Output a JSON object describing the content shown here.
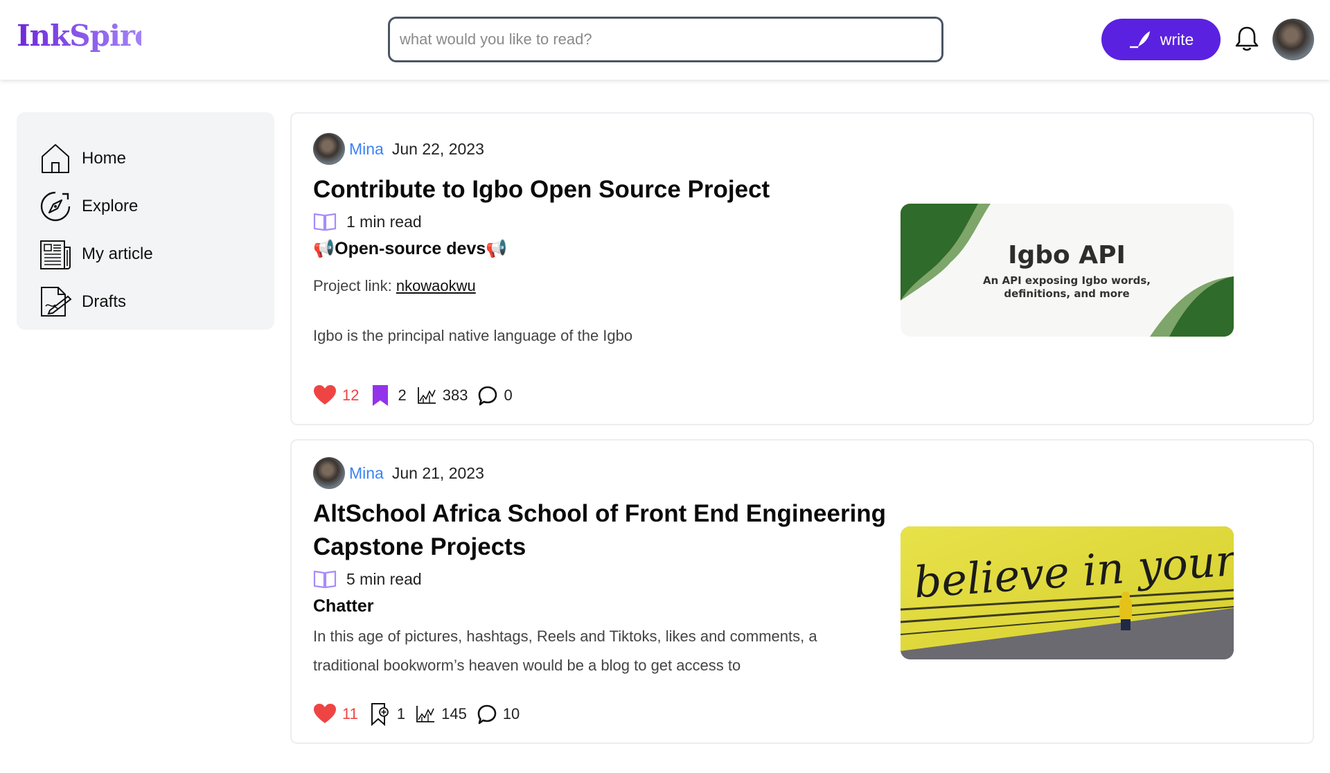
{
  "app": {
    "logo": "InkSpire"
  },
  "header": {
    "search_placeholder": "what would you like to read?",
    "write_label": "write"
  },
  "sidebar": {
    "items": [
      {
        "label": "Home",
        "icon": "home-icon"
      },
      {
        "label": "Explore",
        "icon": "compass-icon"
      },
      {
        "label": "My article",
        "icon": "newspaper-icon"
      },
      {
        "label": "Drafts",
        "icon": "draft-icon"
      }
    ]
  },
  "articles": [
    {
      "author": "Mina",
      "date": "Jun 22, 2023",
      "title": "Contribute to Igbo Open Source Project",
      "read_time": "1 min read",
      "tag": "📢Open-source devs📢",
      "link_prefix": "Project link: ",
      "link_text": "nkowaokwu",
      "excerpt": "Igbo is the principal native language of the Igbo",
      "likes": "12",
      "bookmarks": "2",
      "views": "383",
      "comments": "0",
      "bookmarked": true,
      "image": {
        "title": "Igbo API",
        "subtitle_line1": "An API exposing Igbo words,",
        "subtitle_line2": "definitions, and more"
      }
    },
    {
      "author": "Mina",
      "date": "Jun 21, 2023",
      "title_line1": "AltSchool Africa School of Front End Engineering",
      "title_line2": "Capstone Projects",
      "read_time": "5 min read",
      "tag": "Chatter",
      "excerpt_line1": "In this age of pictures, hashtags, Reels and Tiktoks, likes and comments, a",
      "excerpt_line2": "traditional bookworm’s heaven would be a blog to get access to",
      "likes": "11",
      "bookmarks": "1",
      "views": "145",
      "comments": "10",
      "bookmarked": false,
      "image": {
        "text": "believe in yourself"
      }
    }
  ],
  "colors": {
    "accent": "#5b21e0",
    "logo_gradient_start": "#6d28d9",
    "logo_gradient_end": "#a78bfa",
    "author": "#3b82f6",
    "like": "#ef4444",
    "bookmark": "#9333ea",
    "readtime_icon": "#a78bfa",
    "igbo_green": "#2f6b2a"
  }
}
